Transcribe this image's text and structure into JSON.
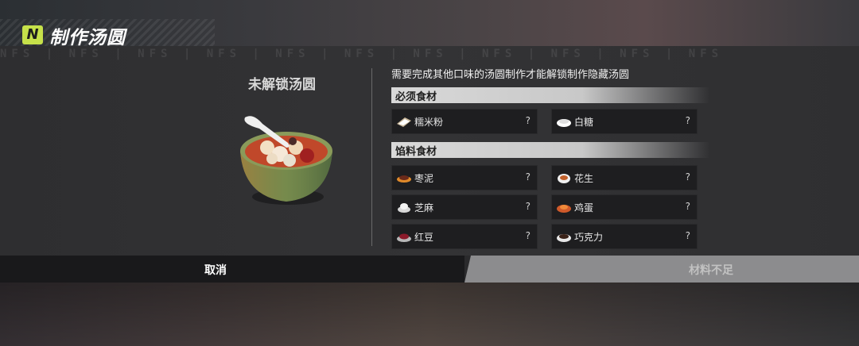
{
  "header": {
    "logo_text": "N",
    "title": "制作汤圆",
    "watermark": "NFS | NFS | NFS | NFS | NFS | NFS | NFS | NFS | NFS | NFS | NFS"
  },
  "left": {
    "title": "未解锁汤圆"
  },
  "right": {
    "requirement": "需要完成其他口味的汤圆制作才能解锁制作隐藏汤圆",
    "required_section": "必须食材",
    "filling_section": "馅料食材",
    "required_items": [
      {
        "name": "糯米粉",
        "qty": "?",
        "icon": "rice-flour-icon"
      },
      {
        "name": "白糖",
        "qty": "?",
        "icon": "sugar-icon"
      }
    ],
    "filling_items": [
      {
        "name": "枣泥",
        "qty": "?",
        "icon": "date-paste-icon"
      },
      {
        "name": "花生",
        "qty": "?",
        "icon": "peanut-icon"
      },
      {
        "name": "芝麻",
        "qty": "?",
        "icon": "sesame-icon"
      },
      {
        "name": "鸡蛋",
        "qty": "?",
        "icon": "egg-icon"
      },
      {
        "name": "红豆",
        "qty": "?",
        "icon": "red-bean-icon"
      },
      {
        "name": "巧克力",
        "qty": "?",
        "icon": "chocolate-icon"
      }
    ]
  },
  "buttons": {
    "cancel": "取消",
    "insufficient": "材料不足"
  },
  "colors": {
    "accent": "#c6e14a",
    "slot_bg": "#1e1e20",
    "disabled_btn": "#8c8c8e"
  }
}
